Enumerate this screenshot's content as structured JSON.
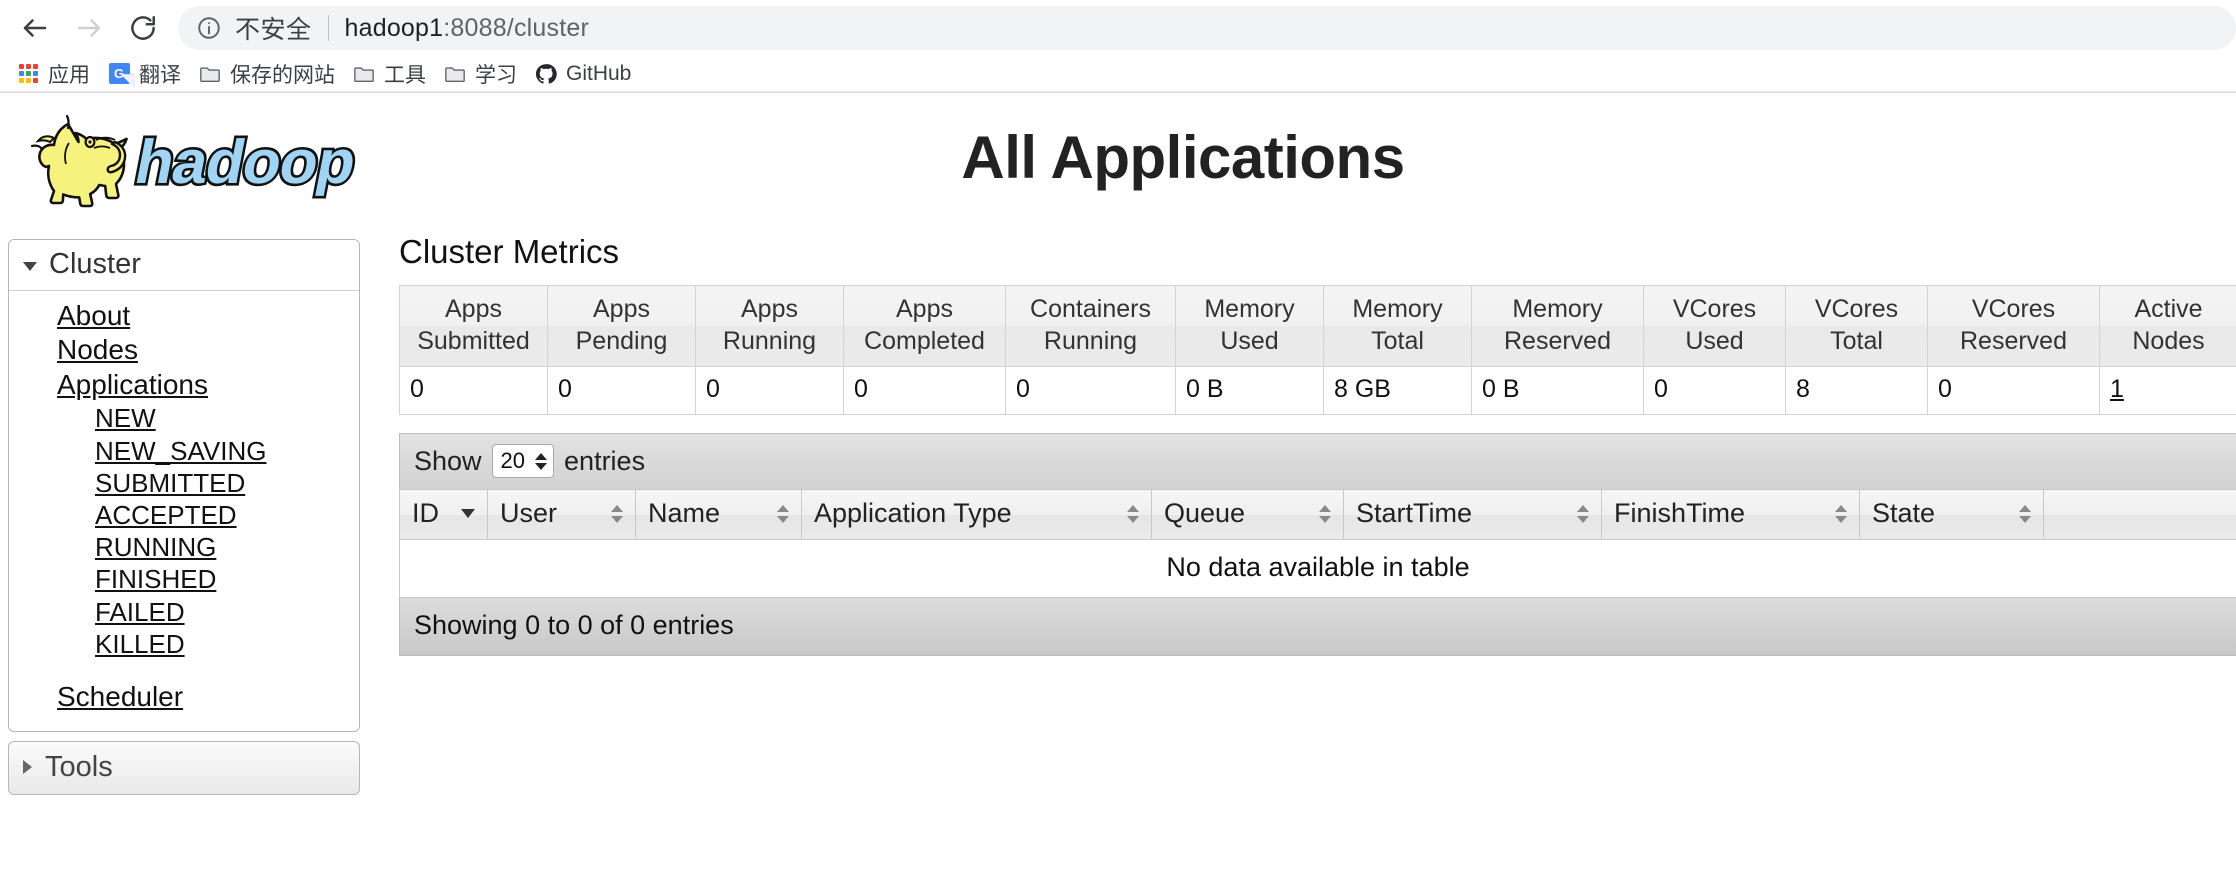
{
  "browser": {
    "back_icon": "back-arrow-icon",
    "forward_icon": "forward-arrow-icon",
    "reload_icon": "reload-icon",
    "omnibox": {
      "info_icon": "info-circle-icon",
      "security_label": "不安全",
      "url_host": "hadoop1",
      "url_path": ":8088/cluster",
      "url_full": "hadoop1:8088/cluster"
    },
    "bookmarks": [
      {
        "label": "应用",
        "icon": "apps-grid-icon"
      },
      {
        "label": "翻译",
        "icon": "google-translate-icon"
      },
      {
        "label": "保存的网站",
        "icon": "folder-icon"
      },
      {
        "label": "工具",
        "icon": "folder-icon"
      },
      {
        "label": "学习",
        "icon": "folder-icon"
      },
      {
        "label": "GitHub",
        "icon": "github-icon"
      }
    ]
  },
  "page": {
    "logo_alt": "hadoop-logo",
    "title": "All Applications"
  },
  "sidebar": {
    "cluster": {
      "header": "Cluster",
      "caret": "caret-down-icon",
      "links": [
        {
          "label": "About",
          "level": "top"
        },
        {
          "label": "Nodes",
          "level": "top"
        },
        {
          "label": "Applications",
          "level": "top"
        },
        {
          "label": "NEW",
          "level": "sub"
        },
        {
          "label": "NEW_SAVING",
          "level": "sub"
        },
        {
          "label": "SUBMITTED",
          "level": "sub"
        },
        {
          "label": "ACCEPTED",
          "level": "sub"
        },
        {
          "label": "RUNNING",
          "level": "sub"
        },
        {
          "label": "FINISHED",
          "level": "sub"
        },
        {
          "label": "FAILED",
          "level": "sub"
        },
        {
          "label": "KILLED",
          "level": "sub"
        },
        {
          "label": "Scheduler",
          "level": "top-spaced"
        }
      ]
    },
    "tools": {
      "header": "Tools",
      "caret": "caret-right-icon"
    }
  },
  "main": {
    "metrics_title": "Cluster Metrics",
    "metrics_columns": [
      {
        "line1": "Apps",
        "line2": "Submitted"
      },
      {
        "line1": "Apps",
        "line2": "Pending"
      },
      {
        "line1": "Apps",
        "line2": "Running"
      },
      {
        "line1": "Apps",
        "line2": "Completed"
      },
      {
        "line1": "Containers",
        "line2": "Running"
      },
      {
        "line1": "Memory",
        "line2": "Used"
      },
      {
        "line1": "Memory",
        "line2": "Total"
      },
      {
        "line1": "Memory",
        "line2": "Reserved"
      },
      {
        "line1": "VCores",
        "line2": "Used"
      },
      {
        "line1": "VCores",
        "line2": "Total"
      },
      {
        "line1": "VCores",
        "line2": "Reserved"
      },
      {
        "line1": "Active",
        "line2": "Nodes"
      }
    ],
    "metrics_values": [
      "0",
      "0",
      "0",
      "0",
      "0",
      "0 B",
      "8 GB",
      "0 B",
      "0",
      "8",
      "0",
      "1"
    ],
    "datatable": {
      "show_label": "Show",
      "entries_label": "entries",
      "page_length": "20",
      "columns": [
        {
          "label": "ID",
          "sort": "desc"
        },
        {
          "label": "User",
          "sort": "both"
        },
        {
          "label": "Name",
          "sort": "both"
        },
        {
          "label": "Application Type",
          "sort": "both"
        },
        {
          "label": "Queue",
          "sort": "both"
        },
        {
          "label": "StartTime",
          "sort": "both"
        },
        {
          "label": "FinishTime",
          "sort": "both"
        },
        {
          "label": "State",
          "sort": "both"
        }
      ],
      "empty_message": "No data available in table",
      "info": "Showing 0 to 0 of 0 entries"
    }
  },
  "colors": {
    "accent": "#4285f4",
    "logo_blue": "#9fd4f5",
    "logo_yellow": "#f2f07a",
    "chrome_bg": "#f1f3f4"
  }
}
